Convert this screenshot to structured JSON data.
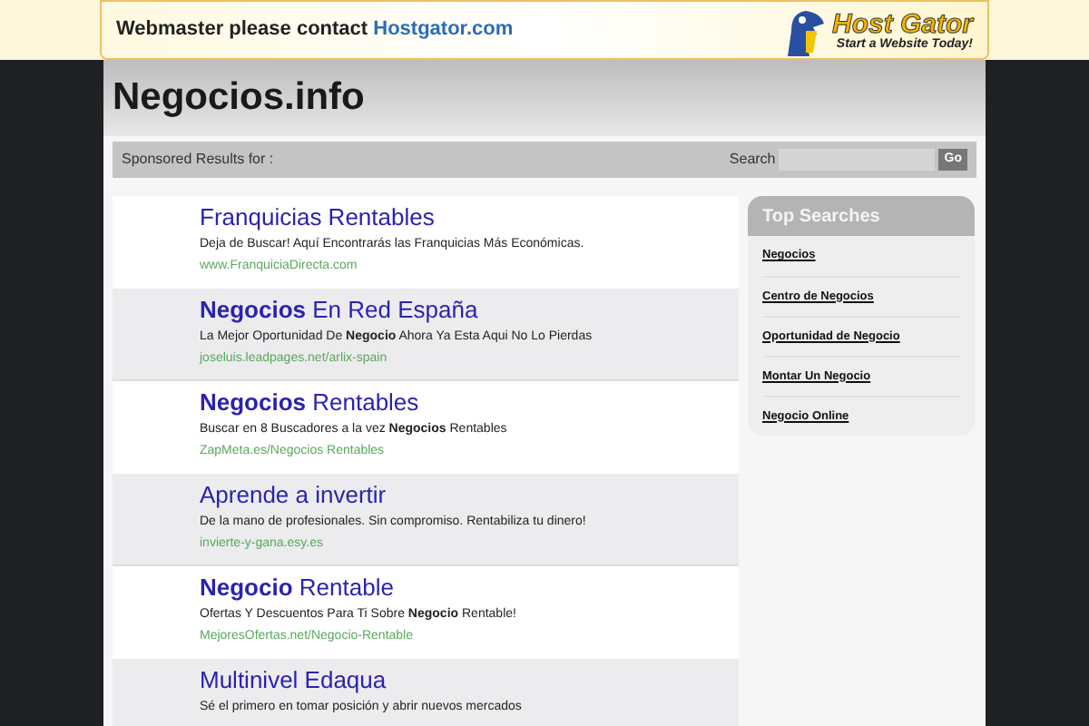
{
  "banner": {
    "text": "Webmaster please contact",
    "link": "Hostgator.com",
    "logo_title": "Host Gator",
    "logo_tagline": "Start a Website Today!"
  },
  "site_title": "Negocios.info",
  "search_bar": {
    "label": "Sponsored Results for :",
    "search_label": "Search",
    "button": "Go"
  },
  "results": [
    {
      "title": "Franquicias Rentables",
      "description": "Deja de Buscar! Aquí Encontrarás las Franquicias Más Económicas.",
      "url": "www.FranquiciaDirecta.com"
    },
    {
      "title": "**Negocios** En Red España",
      "description": "La Mejor Oportunidad De **Negocio** Ahora Ya Esta Aqui No Lo Pierdas",
      "url": "joseluis.leadpages.net/arlix-spain"
    },
    {
      "title": "**Negocios** Rentables",
      "description": "Buscar en 8 Buscadores a la vez **Negocios** Rentables",
      "url": "ZapMeta.es/Negocios Rentables"
    },
    {
      "title": "Aprende a invertir",
      "description": "De la mano de profesionales. Sin compromiso. Rentabiliza tu dinero!",
      "url": "invierte-y-gana.esy.es"
    },
    {
      "title": "**Negocio** Rentable",
      "description": "Ofertas Y Descuentos Para Ti Sobre **Negocio** Rentable!",
      "url": "MejoresOfertas.net/Negocio-Rentable"
    },
    {
      "title": "Multinivel Edaqua",
      "description": "Sé el primero en tomar posición y abrir nuevos mercados"
    }
  ],
  "top_searches": {
    "title": "Top Searches",
    "items": [
      "Negocios",
      "Centro de Negocios",
      "Oportunidad de Negocio",
      "Montar Un Negocio",
      "Negocio Online"
    ]
  }
}
